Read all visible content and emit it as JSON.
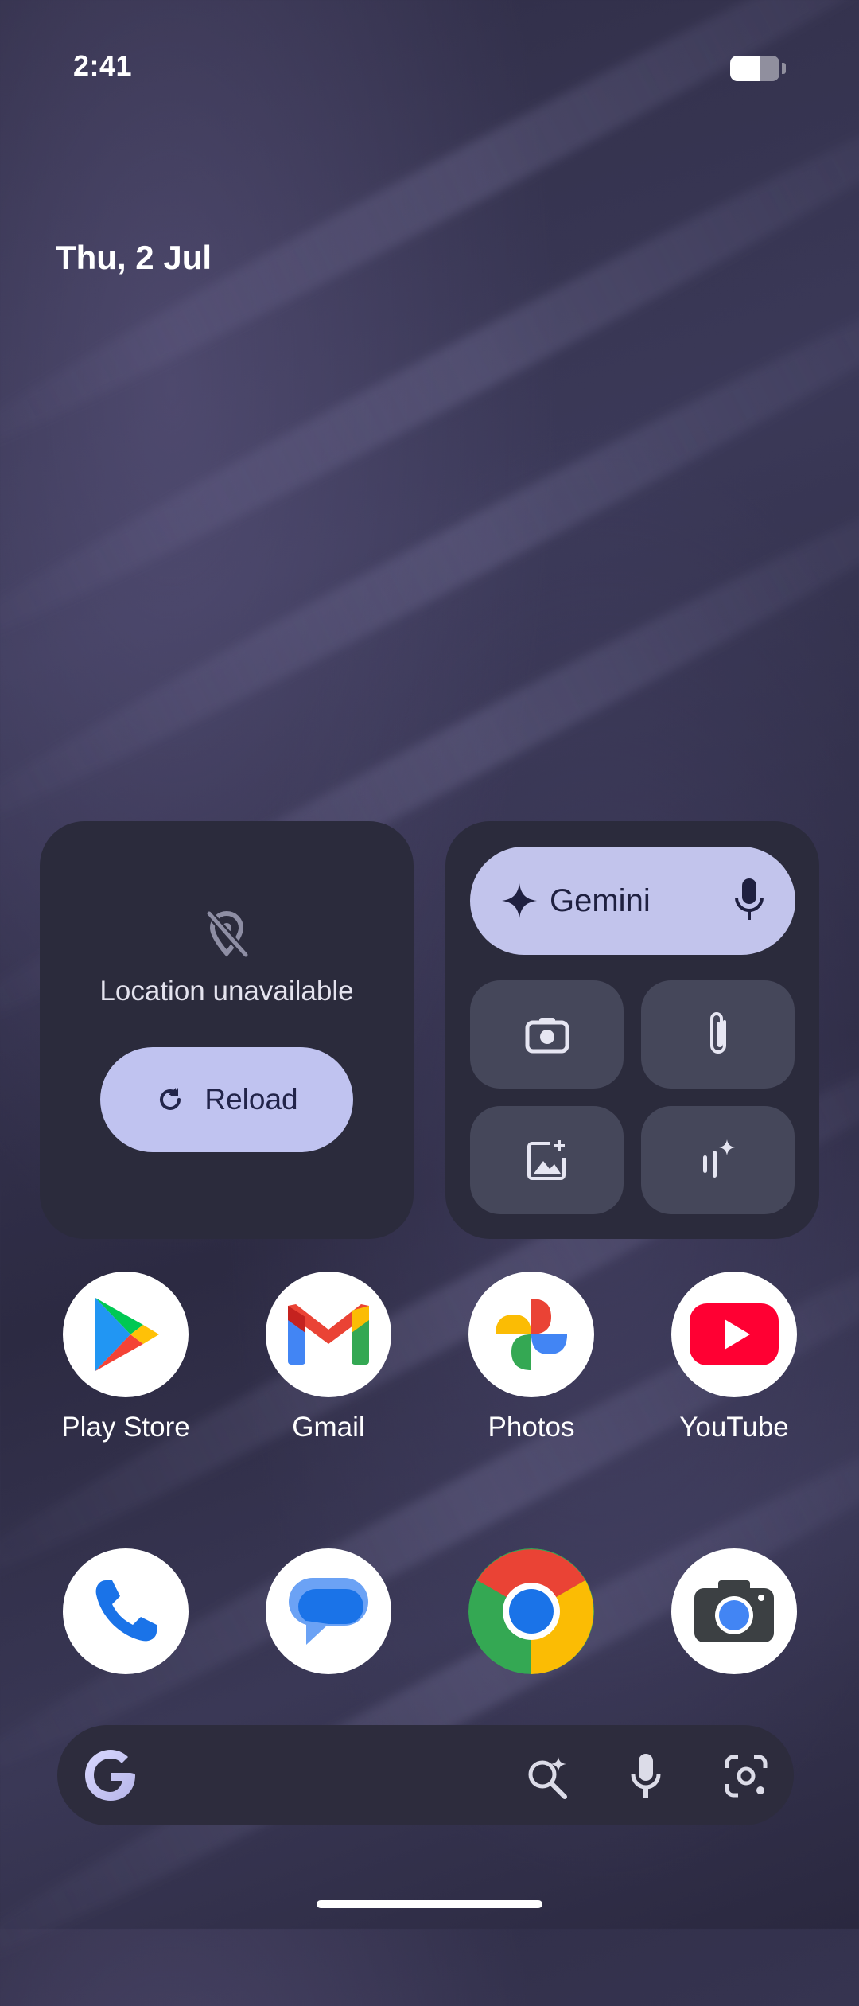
{
  "status_bar": {
    "time": "2:41",
    "battery_level": 0.62
  },
  "date": "Thu, 2 Jul",
  "weather_widget": {
    "icon": "location-off-icon",
    "message": "Location unavailable",
    "reload_label": "Reload"
  },
  "gemini_widget": {
    "label": "Gemini",
    "tiles": [
      "camera-icon",
      "attachment-icon",
      "add-image-icon",
      "live-voice-icon"
    ]
  },
  "apps_row1": [
    {
      "name": "Play Store",
      "icon": "play-store-icon"
    },
    {
      "name": "Gmail",
      "icon": "gmail-icon"
    },
    {
      "name": "Photos",
      "icon": "photos-icon"
    },
    {
      "name": "YouTube",
      "icon": "youtube-icon"
    }
  ],
  "dock": [
    {
      "icon": "phone-icon"
    },
    {
      "icon": "messages-icon"
    },
    {
      "icon": "chrome-icon"
    },
    {
      "icon": "camera-app-icon"
    }
  ],
  "search_bar": {
    "icons": [
      "google-g-icon",
      "ai-search-icon",
      "voice-search-icon",
      "lens-icon"
    ]
  },
  "colors": {
    "widget_bg": "#2b2b3c",
    "accent_pill": "#c0c3f0",
    "tile_bg": "#45475a"
  }
}
